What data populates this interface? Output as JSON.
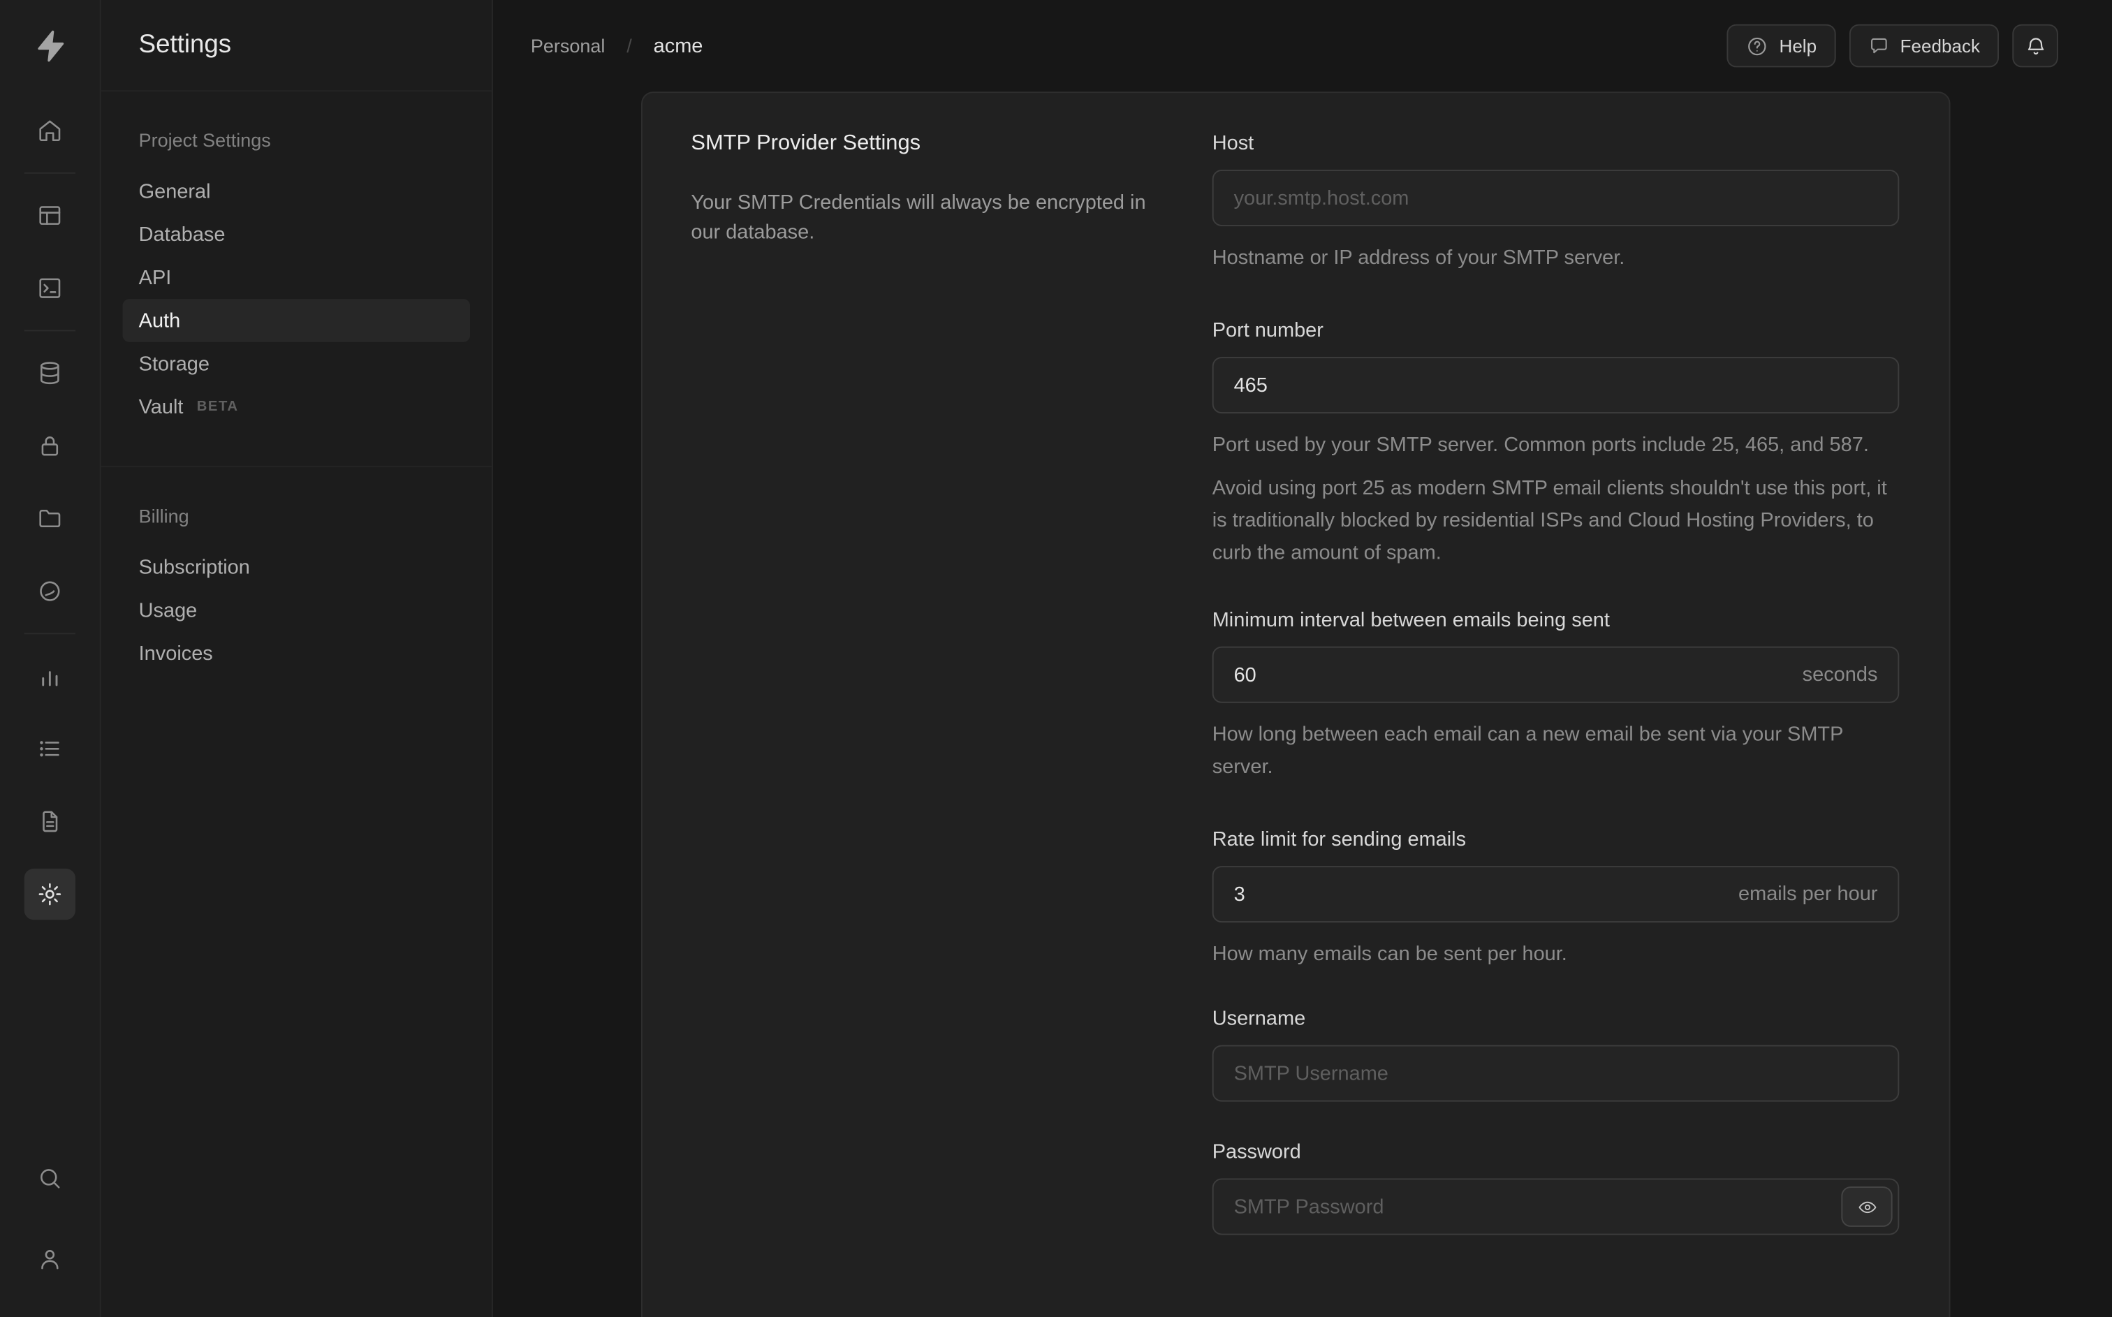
{
  "rail": {
    "logo": "supabase-logo",
    "items": [
      {
        "icon": "home-icon",
        "name": "home"
      },
      {
        "icon": "table-editor-icon",
        "name": "table-editor"
      },
      {
        "icon": "sql-editor-icon",
        "name": "sql-editor"
      },
      {
        "icon": "database-icon",
        "name": "database"
      },
      {
        "icon": "auth-lock-icon",
        "name": "authentication"
      },
      {
        "icon": "storage-icon",
        "name": "storage"
      },
      {
        "icon": "edge-functions-icon",
        "name": "edge-functions"
      },
      {
        "icon": "reports-icon",
        "name": "reports"
      },
      {
        "icon": "logs-icon",
        "name": "logs"
      },
      {
        "icon": "docs-icon",
        "name": "api-docs"
      },
      {
        "icon": "settings-gear-icon",
        "name": "settings",
        "active": true
      }
    ],
    "bottom": [
      {
        "icon": "search-icon",
        "name": "search"
      },
      {
        "icon": "user-icon",
        "name": "account"
      }
    ]
  },
  "sidebar": {
    "title": "Settings",
    "sections": [
      {
        "label": "Project Settings",
        "items": [
          {
            "label": "General"
          },
          {
            "label": "Database"
          },
          {
            "label": "API"
          },
          {
            "label": "Auth",
            "active": true
          },
          {
            "label": "Storage"
          },
          {
            "label": "Vault",
            "badge": "BETA"
          }
        ]
      },
      {
        "label": "Billing",
        "items": [
          {
            "label": "Subscription"
          },
          {
            "label": "Usage"
          },
          {
            "label": "Invoices"
          }
        ]
      }
    ]
  },
  "header": {
    "breadcrumb": {
      "org": "Personal",
      "separator": "/",
      "project": "acme"
    },
    "buttons": {
      "help": "Help",
      "feedback": "Feedback"
    }
  },
  "content": {
    "section_title": "SMTP Provider Settings",
    "section_description": "Your SMTP Credentials will always be encrypted in our database.",
    "fields": {
      "host": {
        "label": "Host",
        "placeholder": "your.smtp.host.com",
        "helper": "Hostname or IP address of your SMTP server."
      },
      "port": {
        "label": "Port number",
        "value": "465",
        "helper": "Port used by your SMTP server. Common ports include 25, 465, and 587.",
        "note": "Avoid using port 25 as modern SMTP email clients shouldn't use this port, it is traditionally blocked by residential ISPs and Cloud Hosting Providers, to curb the amount of spam."
      },
      "interval": {
        "label": "Minimum interval between emails being sent",
        "value": "60",
        "suffix": "seconds",
        "helper": "How long between each email can a new email be sent via your SMTP server."
      },
      "rate": {
        "label": "Rate limit for sending emails",
        "value": "3",
        "suffix": "emails per hour",
        "helper": "How many emails can be sent per hour."
      },
      "username": {
        "label": "Username",
        "placeholder": "SMTP Username"
      },
      "password": {
        "label": "Password",
        "placeholder": "SMTP Password"
      }
    }
  }
}
